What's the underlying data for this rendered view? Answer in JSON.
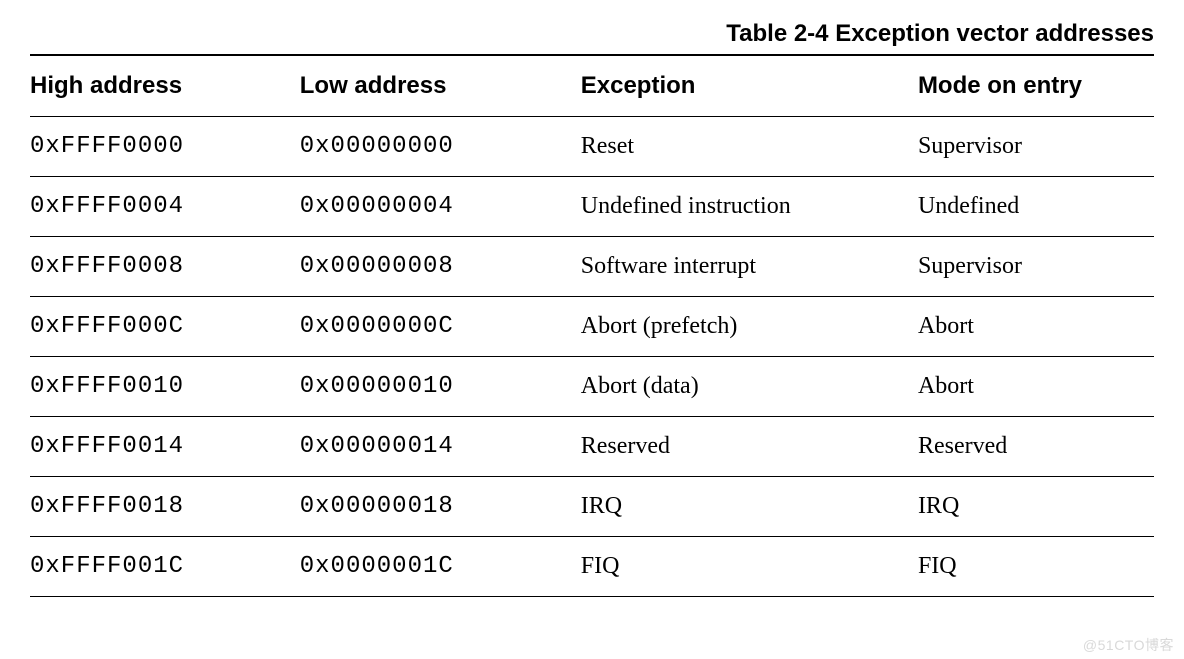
{
  "caption": "Table 2-4 Exception vector addresses",
  "headers": {
    "high_address": "High address",
    "low_address": "Low address",
    "exception": "Exception",
    "mode_on_entry": "Mode on entry"
  },
  "rows": [
    {
      "high": "0xFFFF0000",
      "low": "0x00000000",
      "exception": "Reset",
      "mode": "Supervisor"
    },
    {
      "high": "0xFFFF0004",
      "low": "0x00000004",
      "exception": "Undefined instruction",
      "mode": "Undefined"
    },
    {
      "high": "0xFFFF0008",
      "low": "0x00000008",
      "exception": "Software interrupt",
      "mode": "Supervisor"
    },
    {
      "high": "0xFFFF000C",
      "low": "0x0000000C",
      "exception": "Abort (prefetch)",
      "mode": "Abort"
    },
    {
      "high": "0xFFFF0010",
      "low": "0x00000010",
      "exception": "Abort (data)",
      "mode": "Abort"
    },
    {
      "high": "0xFFFF0014",
      "low": "0x00000014",
      "exception": "Reserved",
      "mode": "Reserved"
    },
    {
      "high": "0xFFFF0018",
      "low": "0x00000018",
      "exception": "IRQ",
      "mode": "IRQ"
    },
    {
      "high": "0xFFFF001C",
      "low": "0x0000001C",
      "exception": "FIQ",
      "mode": "FIQ"
    }
  ],
  "watermark": "@51CTO博客",
  "chart_data": {
    "type": "table",
    "title": "Table 2-4 Exception vector addresses",
    "columns": [
      "High address",
      "Low address",
      "Exception",
      "Mode on entry"
    ],
    "rows": [
      [
        "0xFFFF0000",
        "0x00000000",
        "Reset",
        "Supervisor"
      ],
      [
        "0xFFFF0004",
        "0x00000004",
        "Undefined instruction",
        "Undefined"
      ],
      [
        "0xFFFF0008",
        "0x00000008",
        "Software interrupt",
        "Supervisor"
      ],
      [
        "0xFFFF000C",
        "0x0000000C",
        "Abort (prefetch)",
        "Abort"
      ],
      [
        "0xFFFF0010",
        "0x00000010",
        "Abort (data)",
        "Abort"
      ],
      [
        "0xFFFF0014",
        "0x00000014",
        "Reserved",
        "Reserved"
      ],
      [
        "0xFFFF0018",
        "0x00000018",
        "IRQ",
        "IRQ"
      ],
      [
        "0xFFFF001C",
        "0x0000001C",
        "FIQ",
        "FIQ"
      ]
    ]
  }
}
